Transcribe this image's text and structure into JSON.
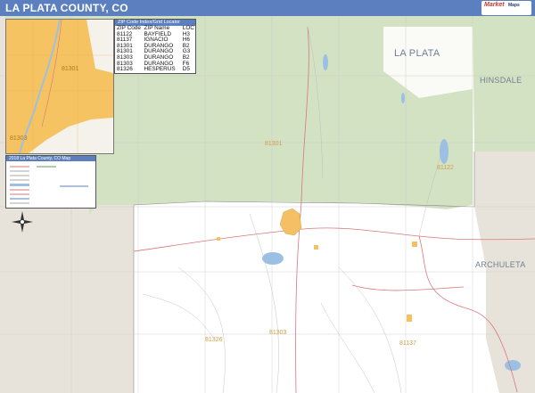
{
  "header": {
    "title": "LA PLATA COUNTY, CO"
  },
  "logo": {
    "line1": "Market",
    "line2": "Maps"
  },
  "zip_index": {
    "title": "ZIP Code Index/Grid Locator",
    "columns": [
      "ZIP Code",
      "ZIP Name",
      "LOC"
    ],
    "rows": [
      [
        "81122",
        "BAYFIELD",
        "H3"
      ],
      [
        "81137",
        "IGNACIO",
        "H6"
      ],
      [
        "81301",
        "DURANGO",
        "B2"
      ],
      [
        "81301",
        "DURANGO",
        "G3"
      ],
      [
        "81303",
        "DURANGO",
        "B2"
      ],
      [
        "81303",
        "DURANGO",
        "F6"
      ],
      [
        "81326",
        "HESPERUS",
        "D5"
      ]
    ]
  },
  "legend": {
    "title": "2018 La Plata County, CO Map"
  },
  "region_labels": {
    "la_plata": "LA PLATA",
    "hinsdale": "HINSDALE",
    "archuleta": "ARCHULETA"
  },
  "zip_labels": {
    "z81301_main": "81301",
    "z81122": "81122",
    "z81326": "81326",
    "z81303": "81303",
    "z81137": "81137"
  },
  "inset_labels": {
    "a": "81301",
    "b": "81303"
  },
  "colors": {
    "title_bar": "#5b7fbf",
    "forest": "#cfe0bf",
    "city": "#f4c063",
    "water": "#9cc0e4",
    "neighbor": "#e8e3da"
  }
}
